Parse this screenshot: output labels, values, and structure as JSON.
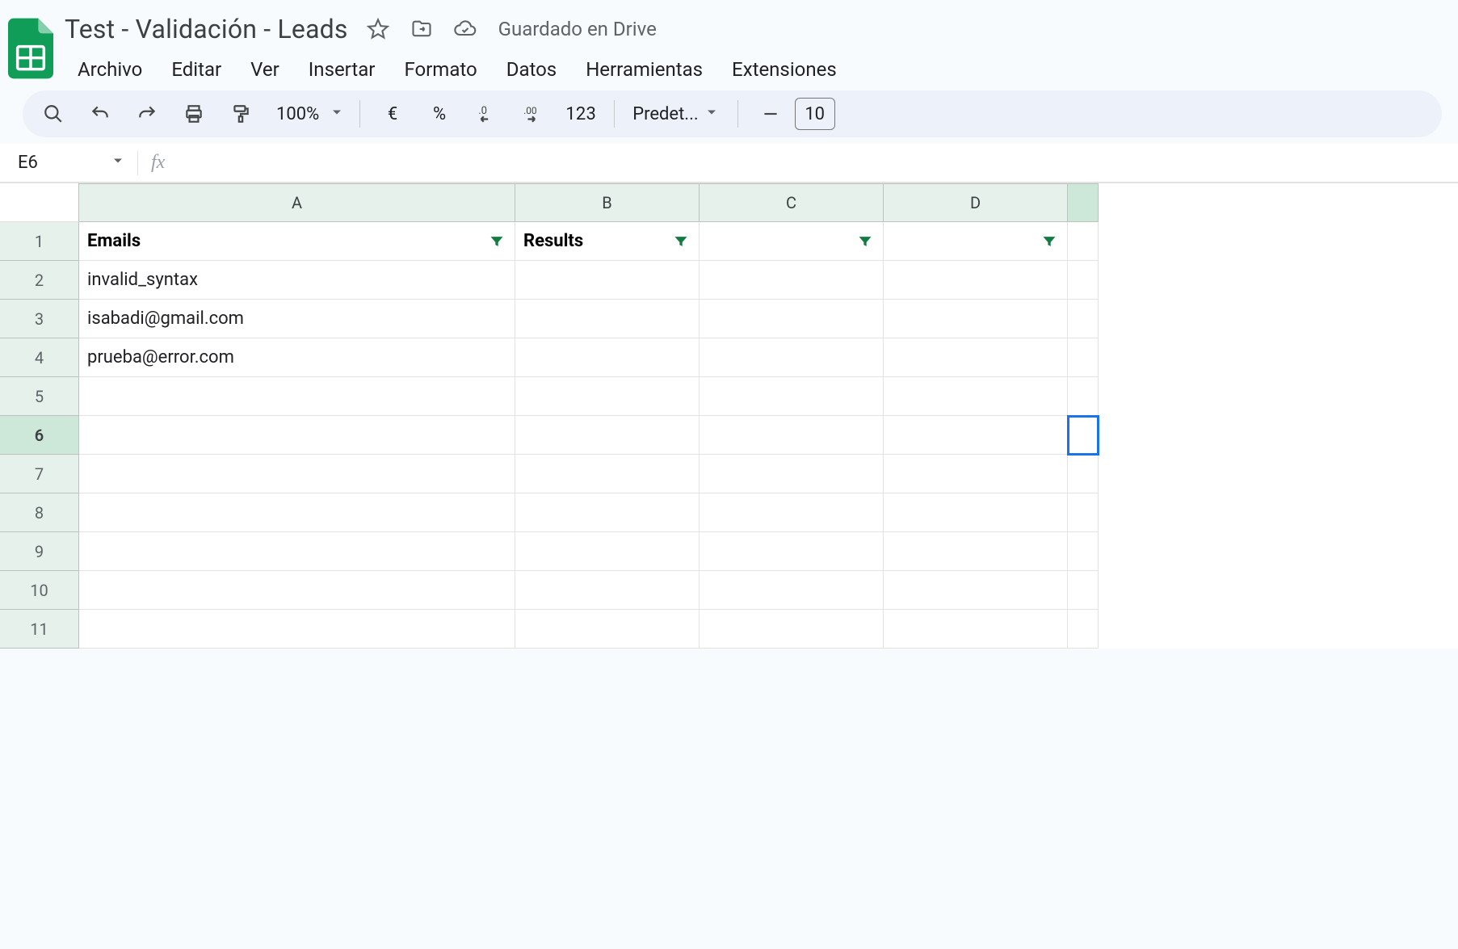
{
  "header": {
    "doc_title": "Test - Validación - Leads",
    "save_status": "Guardado en Drive"
  },
  "menubar": [
    "Archivo",
    "Editar",
    "Ver",
    "Insertar",
    "Formato",
    "Datos",
    "Herramientas",
    "Extensiones"
  ],
  "toolbar": {
    "zoom": "100%",
    "currency_symbol": "€",
    "percent_symbol": "%",
    "number_format_label": "123",
    "font_name": "Predet...",
    "font_size": "10"
  },
  "formula_bar": {
    "name_box": "E6",
    "formula": ""
  },
  "grid": {
    "columns": [
      "A",
      "B",
      "C",
      "D",
      ""
    ],
    "rows": [
      "1",
      "2",
      "3",
      "4",
      "5",
      "6",
      "7",
      "8",
      "9",
      "10",
      "11"
    ],
    "active_cell": {
      "row": 6,
      "col": "E"
    },
    "header_row": [
      "Emails",
      "Results",
      "",
      "",
      ""
    ],
    "data": [
      [
        "invalid_syntax",
        "",
        "",
        "",
        ""
      ],
      [
        "isabadi@gmail.com",
        "",
        "",
        "",
        ""
      ],
      [
        "prueba@error.com",
        "",
        "",
        "",
        ""
      ],
      [
        "",
        "",
        "",
        "",
        ""
      ],
      [
        "",
        "",
        "",
        "",
        ""
      ],
      [
        "",
        "",
        "",
        "",
        ""
      ],
      [
        "",
        "",
        "",
        "",
        ""
      ],
      [
        "",
        "",
        "",
        "",
        ""
      ],
      [
        "",
        "",
        "",
        "",
        ""
      ],
      [
        "",
        "",
        "",
        "",
        ""
      ]
    ]
  }
}
